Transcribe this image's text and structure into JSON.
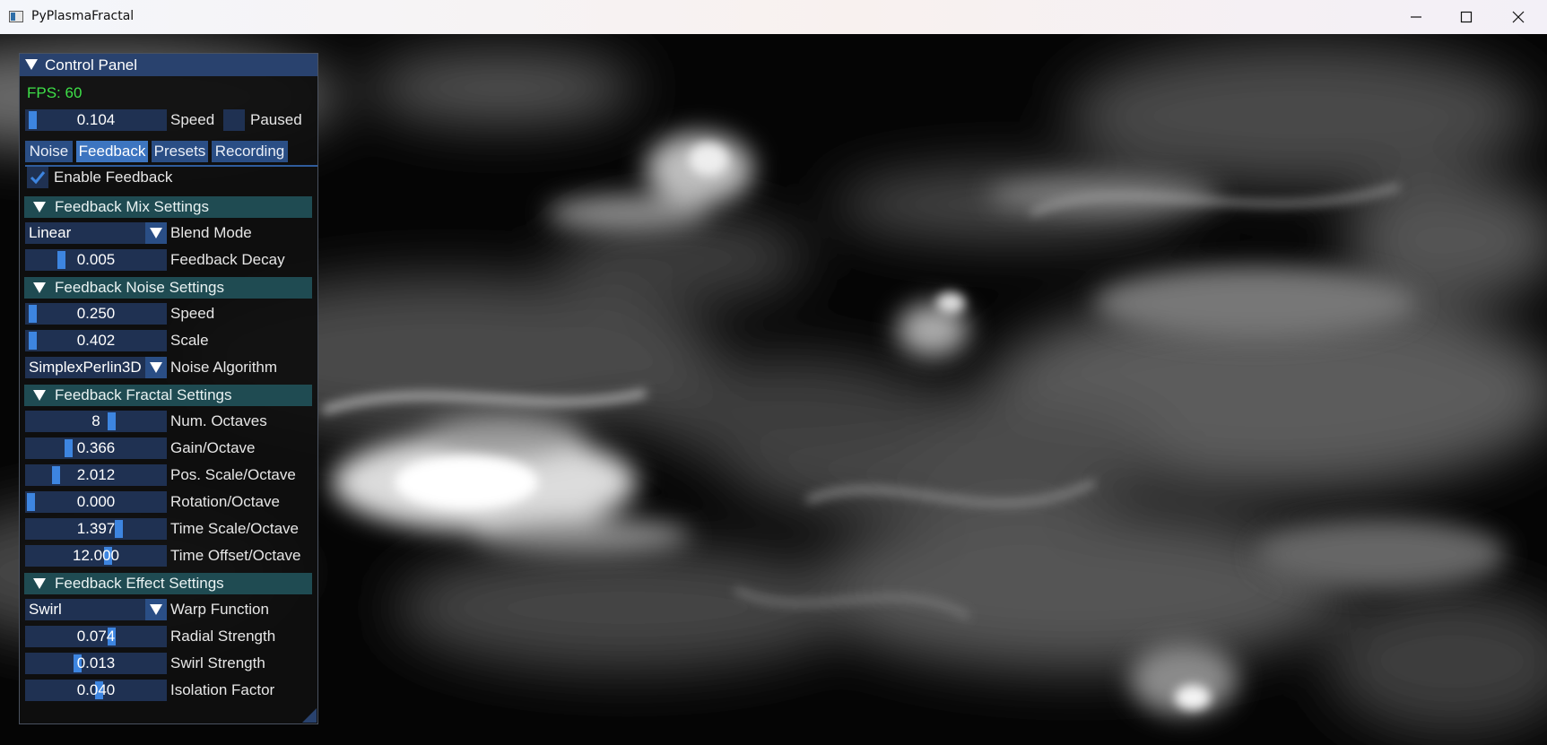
{
  "window": {
    "title": "PyPlasmaFractal"
  },
  "panel": {
    "title": "Control Panel",
    "fps_text": "FPS: 60",
    "speed": {
      "value": "0.104",
      "label": "Speed",
      "fill": 0.104
    },
    "paused_label": "Paused",
    "tabs": [
      "Noise",
      "Feedback",
      "Presets",
      "Recording"
    ],
    "active_tab": "Feedback",
    "enable_feedback_label": "Enable Feedback",
    "sections": {
      "mix": "Feedback Mix Settings",
      "noise": "Feedback Noise Settings",
      "fractal": "Feedback Fractal Settings",
      "effect": "Feedback Effect Settings"
    },
    "blend_mode": {
      "value": "Linear",
      "label": "Blend Mode"
    },
    "feedback_decay": {
      "value": "0.005",
      "label": "Feedback Decay"
    },
    "noise_speed": {
      "value": "0.250",
      "label": "Speed"
    },
    "noise_scale": {
      "value": "0.402",
      "label": "Scale"
    },
    "noise_algorithm": {
      "value": "SimplexPerlin3D",
      "label": "Noise Algorithm"
    },
    "num_octaves": {
      "value": "8",
      "label": "Num. Octaves"
    },
    "gain_octave": {
      "value": "0.366",
      "label": "Gain/Octave"
    },
    "pos_scale_octave": {
      "value": "2.012",
      "label": "Pos. Scale/Octave"
    },
    "rotation_octave": {
      "value": "0.000",
      "label": "Rotation/Octave"
    },
    "time_scale_octave": {
      "value": "1.397",
      "label": "Time Scale/Octave"
    },
    "time_offset_octave": {
      "value": "12.000",
      "label": "Time Offset/Octave"
    },
    "warp_function": {
      "value": "Swirl",
      "label": "Warp Function"
    },
    "radial_strength": {
      "value": "0.074",
      "label": "Radial Strength"
    },
    "swirl_strength": {
      "value": "0.013",
      "label": "Swirl Strength"
    },
    "isolation_factor": {
      "value": "0.040",
      "label": "Isolation Factor"
    }
  },
  "colors": {
    "panel_header": "#29426e",
    "section_header": "#1f4b52",
    "slider_bg": "#1f3152",
    "slider_grab": "#3d85e0",
    "fps_text": "#3ee048",
    "check_mark": "#3d85e0"
  }
}
